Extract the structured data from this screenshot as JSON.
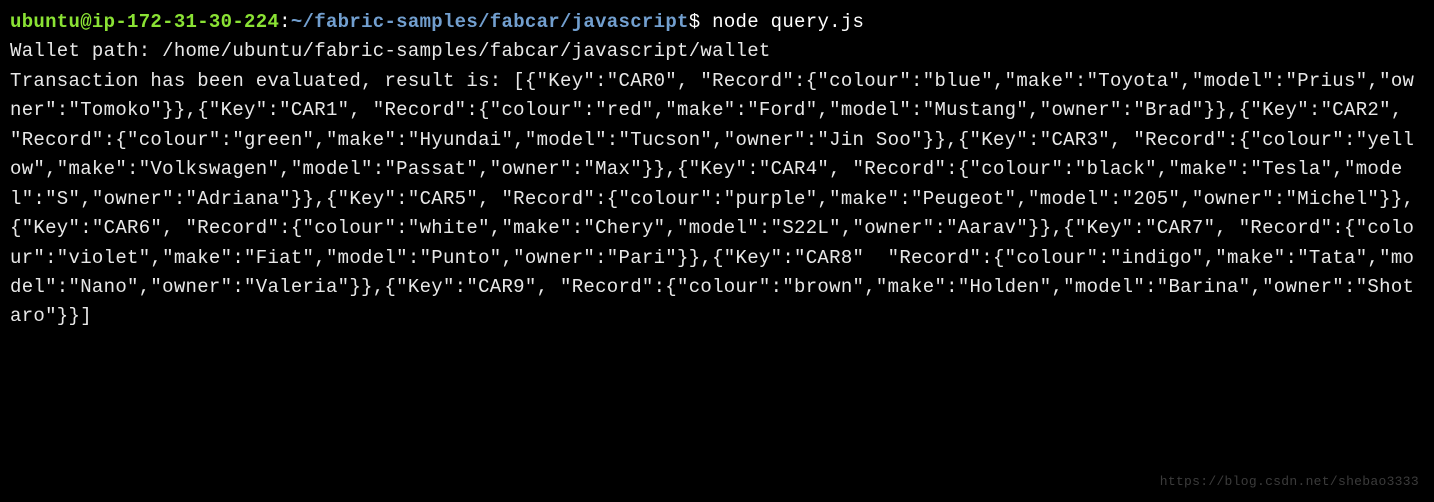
{
  "prompt": {
    "user_host": "ubuntu@ip-172-31-30-224",
    "colon": ":",
    "path": "~/fabric-samples/fabcar/javascript",
    "dollar": "$",
    "command": " node query.js"
  },
  "output_line1": "Wallet path: /home/ubuntu/fabric-samples/fabcar/javascript/wallet",
  "output_line2": "Transaction has been evaluated, result is: [{\"Key\":\"CAR0\", \"Record\":{\"colour\":\"blue\",\"make\":\"Toyota\",\"model\":\"Prius\",\"owner\":\"Tomoko\"}},{\"Key\":\"CAR1\", \"Record\":{\"colour\":\"red\",\"make\":\"Ford\",\"model\":\"Mustang\",\"owner\":\"Brad\"}},{\"Key\":\"CAR2\", \"Record\":{\"colour\":\"green\",\"make\":\"Hyundai\",\"model\":\"Tucson\",\"owner\":\"Jin Soo\"}},{\"Key\":\"CAR3\", \"Record\":{\"colour\":\"yellow\",\"make\":\"Volkswagen\",\"model\":\"Passat\",\"owner\":\"Max\"}},{\"Key\":\"CAR4\", \"Record\":{\"colour\":\"black\",\"make\":\"Tesla\",\"model\":\"S\",\"owner\":\"Adriana\"}},{\"Key\":\"CAR5\", \"Record\":{\"colour\":\"purple\",\"make\":\"Peugeot\",\"model\":\"205\",\"owner\":\"Michel\"}},{\"Key\":\"CAR6\", \"Record\":{\"colour\":\"white\",\"make\":\"Chery\",\"model\":\"S22L\",\"owner\":\"Aarav\"}},{\"Key\":\"CAR7\", \"Record\":{\"colour\":\"violet\",\"make\":\"Fiat\",\"model\":\"Punto\",\"owner\":\"Pari\"}},{\"Key\":\"CAR8\"  \"Record\":{\"colour\":\"indigo\",\"make\":\"Tata\",\"model\":\"Nano\",\"owner\":\"Valeria\"}},{\"Key\":\"CAR9\", \"Record\":{\"colour\":\"brown\",\"make\":\"Holden\",\"model\":\"Barina\",\"owner\":\"Shotaro\"}}]",
  "watermark": "https://blog.csdn.net/shebao3333"
}
